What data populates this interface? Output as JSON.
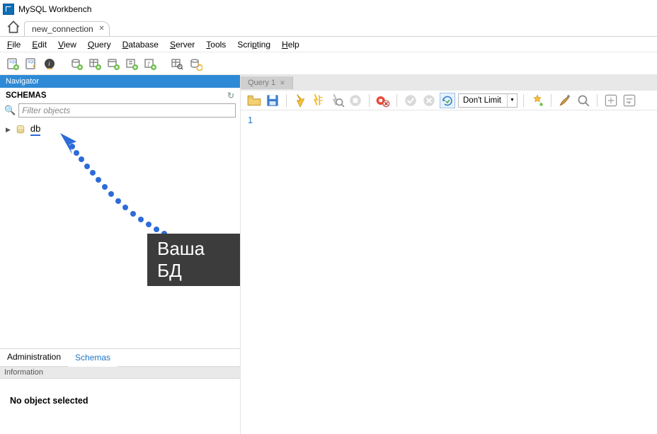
{
  "titlebar": {
    "title": "MySQL Workbench"
  },
  "conn_tab": {
    "label": "new_connection"
  },
  "menu": {
    "file": "File",
    "edit": "Edit",
    "view": "View",
    "query": "Query",
    "database": "Database",
    "server": "Server",
    "tools": "Tools",
    "scripting": "Scripting",
    "help": "Help"
  },
  "navigator": {
    "header": "Navigator",
    "schemas_label": "SCHEMAS",
    "filter_placeholder": "Filter objects",
    "items": [
      {
        "name": "db"
      }
    ]
  },
  "left_tabs": {
    "administration": "Administration",
    "schemas": "Schemas"
  },
  "info": {
    "header": "Information",
    "body": "No object selected"
  },
  "annotation": {
    "label": "Ваша БД"
  },
  "query": {
    "tab_label": "Query 1",
    "limit_label": "Don't Limit",
    "gutter_line": "1"
  }
}
